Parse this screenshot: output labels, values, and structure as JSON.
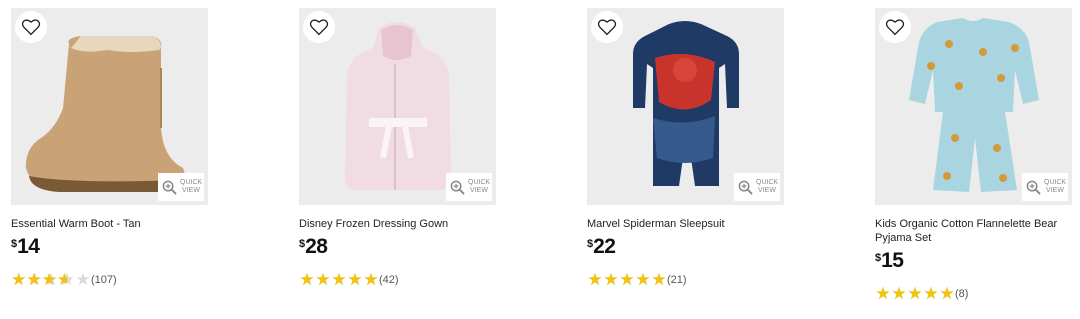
{
  "products": [
    {
      "name": "Essential Warm Boot - Tan",
      "currency": "$",
      "price": "14",
      "rating": 3.5,
      "reviews": "(107)",
      "image": "boot-icon"
    },
    {
      "name": "Disney Frozen Dressing Gown",
      "currency": "$",
      "price": "28",
      "rating": 5,
      "reviews": "(42)",
      "image": "dressing-gown-icon"
    },
    {
      "name": "Marvel Spiderman Sleepsuit",
      "currency": "$",
      "price": "22",
      "rating": 5,
      "reviews": "(21)",
      "image": "sleepsuit-icon"
    },
    {
      "name": "Kids Organic Cotton Flannelette Bear Pyjama Set",
      "currency": "$",
      "price": "15",
      "rating": 5,
      "reviews": "(8)",
      "image": "pyjama-set-icon"
    }
  ],
  "quick_view_label": "QUICK VIEW",
  "colors": {
    "star": "#f4c20d",
    "star_empty": "#d9d9d9",
    "image_bg": "#ececec"
  }
}
